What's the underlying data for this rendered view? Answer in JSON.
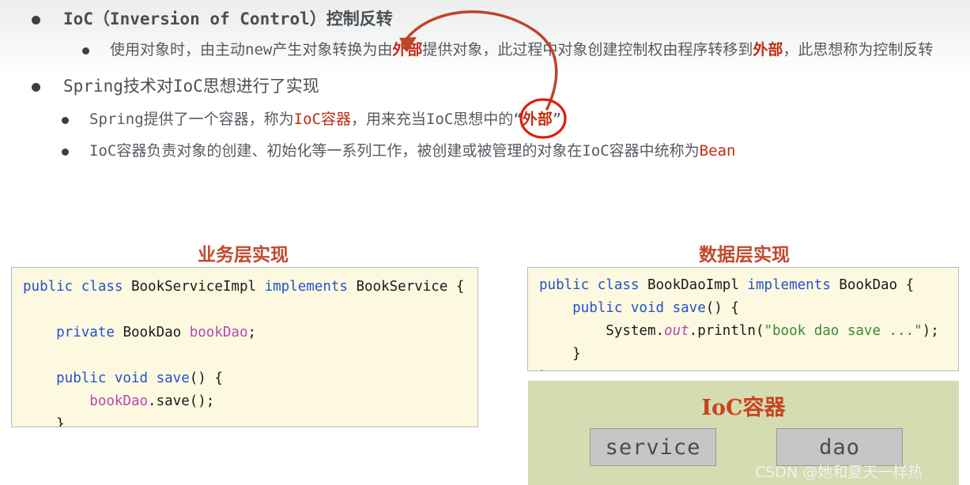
{
  "slide": {
    "bullets": [
      {
        "level": 1,
        "segments": [
          {
            "text": "IoC（Inversion of Control）",
            "style": "red-b"
          },
          {
            "text": "控制反转",
            "style": "red-b"
          }
        ],
        "plain": "IoC（Inversion of Control）控制反转"
      },
      {
        "level": 2,
        "plain": "使用对象时，由主动new产生对象转换为由外部提供对象，此过程中对象创建控制权由程序转移到外部，此思想称为控制反转",
        "parts": {
          "a": "使用对象时，由主动new产生对象转换为由",
          "hl1": "外部",
          "b": "提供对象，此过程中对象创建控制权由程序转移到",
          "hl2": "外部",
          "c": "，此思想称为控制反转"
        }
      },
      {
        "level": 1,
        "plain": "Spring技术对IoC思想进行了实现"
      },
      {
        "level": 2,
        "plain": "Spring提供了一个容器，称为IoC容器，用来充当IoC思想中的“外部”",
        "parts": {
          "a": "Spring提供了一个容器，称为",
          "hl1": "IoC容器",
          "b": "，用来充当IoC思想中的“",
          "hl2": "外部",
          "c": "”"
        }
      },
      {
        "level": 2,
        "plain": "IoC容器负责对象的创建、初始化等一系列工作，被创建或被管理的对象在IoC容器中统称为Bean",
        "parts": {
          "a": "IoC容器负责对象的创建、初始化等一系列工作，被创建或被管理的对象在IoC容器中统称为",
          "hl1": "Bean",
          "b": "",
          "hl2": "",
          "c": ""
        }
      }
    ]
  },
  "annotations": {
    "arrow_color": "#bf4326",
    "ellipse_color": "#e01b0c",
    "arrow_name": "curved-arrow-annotation",
    "ellipse_name": "ellipse-highlight-annotation"
  },
  "service_section": {
    "title": "业务层实现",
    "code": {
      "l1_kw1": "public",
      "l1_kw2": "class",
      "l1_name": " BookServiceImpl ",
      "l1_kw3": "implements",
      "l1_iface": " BookService {",
      "l3_kw": "    private",
      "l3_type": " BookDao ",
      "l3_fld": "bookDao",
      "l3_end": ";",
      "l5_kw1": "    public",
      "l5_kw2": " void",
      "l5_kw3": " save",
      "l5_rest": "() {",
      "l6_fld": "        bookDao",
      "l6_rest": ".save();",
      "l7": "    }",
      "l8": "}"
    }
  },
  "dao_section": {
    "title": "数据层实现",
    "code": {
      "l1_kw1": "public",
      "l1_kw2": " class",
      "l1_name": " BookDaoImpl ",
      "l1_kw3": "implements",
      "l1_iface": " BookDao {",
      "l2_kw1": "    public",
      "l2_kw2": " void",
      "l2_kw3": " save",
      "l2_rest": "() {",
      "l3_pre": "        System.",
      "l3_itl": "out",
      "l3_mid": ".println(",
      "l3_str": "\"book dao save ...\"",
      "l3_end": ");",
      "l4": "    }",
      "l5": "}"
    }
  },
  "ioc_container": {
    "title": "IoC容器",
    "beans": [
      {
        "label": "service"
      },
      {
        "label": "dao"
      }
    ]
  },
  "watermark": {
    "text": "CSDN @她和夏天一样热"
  }
}
